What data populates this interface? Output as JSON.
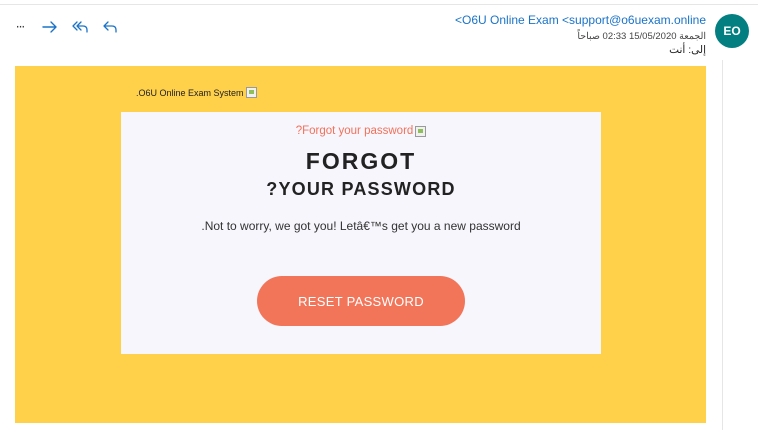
{
  "header": {
    "sender": "<O6U Online Exam <support@o6uexam.online",
    "datetime": "الجمعة 15/05/2020 02:33 صباحاً",
    "to": "إلى: أنت",
    "avatar_initials": "EO",
    "avatar_color": "#037f82"
  },
  "toolbar": {
    "icons": [
      "more-icon",
      "forward-icon",
      "reply-all-icon",
      "reply-icon"
    ],
    "more_label": "···"
  },
  "email": {
    "background_color": "#ffd04a",
    "logo_alt": ".O6U Online Exam System",
    "image_alt": "?Forgot your password",
    "title_line1": "FORGOT",
    "title_line2": "?YOUR PASSWORD",
    "message": ".Not to worry, we got you! Letâ€™s get you a new password",
    "button_label": "RESET PASSWORD",
    "button_color": "#f27459"
  }
}
